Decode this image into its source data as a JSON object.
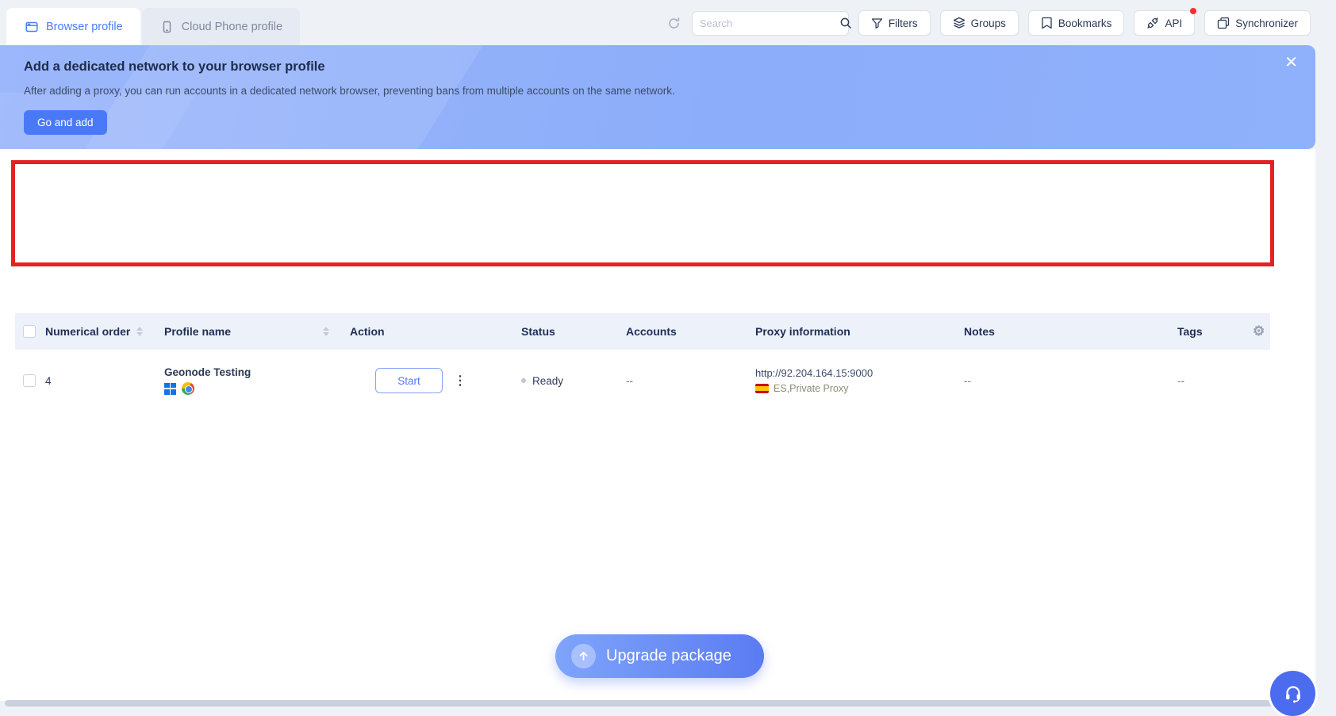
{
  "tabs": {
    "browser": "Browser profile",
    "cloud_phone": "Cloud Phone profile"
  },
  "toolbar": {
    "search_placeholder": "Search",
    "filters": "Filters",
    "groups": "Groups",
    "bookmarks": "Bookmarks",
    "api": "API",
    "synchronizer": "Synchronizer"
  },
  "banner": {
    "title": "Add a dedicated network to your browser profile",
    "description": "After adding a proxy, you can run accounts in a dedicated network browser, preventing bans from multiple accounts on the same network.",
    "cta": "Go and add",
    "close_glyph": "✕"
  },
  "table": {
    "headers": [
      "Numerical order",
      "Profile name",
      "Action",
      "Status",
      "Accounts",
      "Proxy information",
      "Notes",
      "Tags"
    ],
    "row": {
      "numerical_order": "4",
      "profile_name": "Geonode Testing",
      "action": "Start",
      "status": "Ready",
      "accounts": "--",
      "proxy_url": "http://92.204.164.15:9000",
      "proxy_location": "ES,Private Proxy",
      "notes": "--",
      "tags": "--"
    }
  },
  "icons": {
    "kebab_glyph": "⋮",
    "gear_glyph": "⚙"
  },
  "footer": {
    "upgrade": "Upgrade package"
  },
  "colors": {
    "accent": "#4a7df8",
    "banner_blue": "#8fb0fa",
    "cta_blue": "#4a79f7",
    "annotation_red": "#e32222",
    "api_badge_red": "#f23030"
  }
}
